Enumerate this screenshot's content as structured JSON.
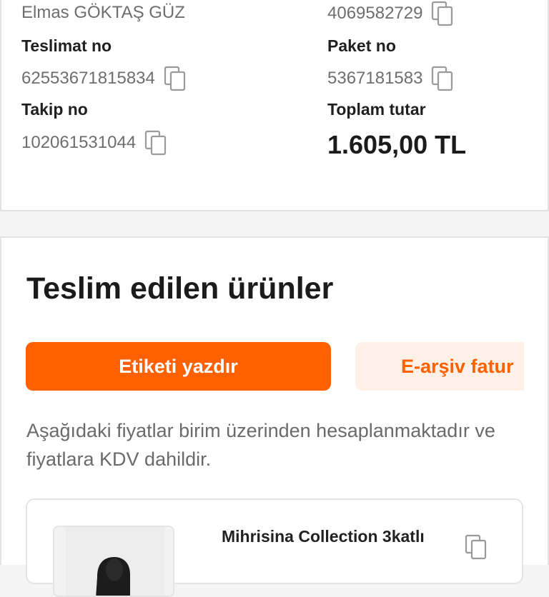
{
  "order_info": {
    "customer_name": "Elmas GÖKTAŞ GÜZ",
    "order_no_value": "4069582729",
    "delivery_no_label": "Teslimat no",
    "delivery_no_value": "62553671815834",
    "package_no_label": "Paket no",
    "package_no_value": "5367181583",
    "tracking_no_label": "Takip no",
    "tracking_no_value": "102061531044",
    "total_label": "Toplam tutar",
    "total_value": "1.605,00 TL"
  },
  "delivered_section": {
    "title": "Teslim edilen ürünler",
    "print_label_button": "Etiketi yazdır",
    "einvoice_button": "E-arşiv fatur",
    "price_note": "Aşağıdaki fiyatlar birim üzerinden hesaplanmaktadır ve fiyatlara KDV dahildir.",
    "product": {
      "title": "Mihrisina Collection 3katlı"
    }
  },
  "colors": {
    "accent": "#ff6000",
    "accent_light": "#fff1e7"
  }
}
